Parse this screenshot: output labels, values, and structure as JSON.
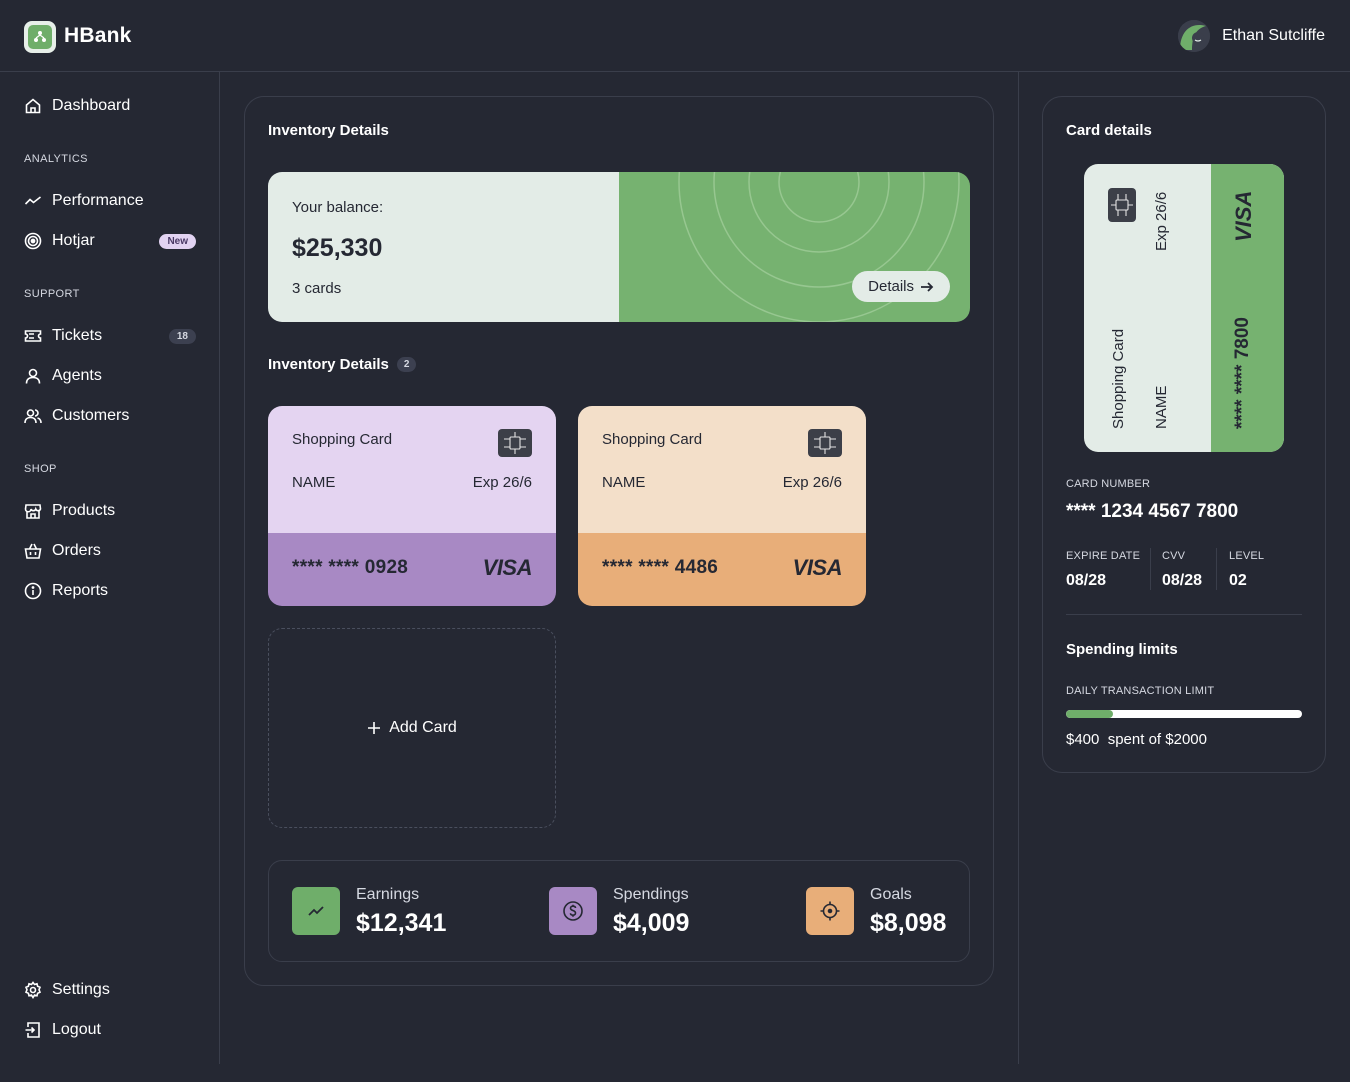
{
  "header": {
    "brand": "HBank",
    "user_name": "Ethan Sutcliffe"
  },
  "sidebar": {
    "dashboard": "Dashboard",
    "analytics_label": "ANALYTICS",
    "performance": "Performance",
    "hotjar": "Hotjar",
    "hotjar_badge": "New",
    "support_label": "SUPPORT",
    "tickets": "Tickets",
    "tickets_count": "18",
    "agents": "Agents",
    "customers": "Customers",
    "shop_label": "SHOP",
    "products": "Products",
    "orders": "Orders",
    "reports": "Reports",
    "settings": "Settings",
    "logout": "Logout"
  },
  "main": {
    "title": "Inventory Details",
    "balance": {
      "label": "Your balance:",
      "amount": "$25,330",
      "cards": "3 cards",
      "details_btn": "Details"
    },
    "cards_section": {
      "title": "Inventory Details",
      "count": "2"
    },
    "cards": [
      {
        "title": "Shopping Card",
        "name": "NAME",
        "exp": "Exp 26/6",
        "number": "**** **** 0928",
        "brand": "VISA",
        "top_color": "#e4d4f1",
        "bottom_color": "#a889c4"
      },
      {
        "title": "Shopping Card",
        "name": "NAME",
        "exp": "Exp 26/6",
        "number": "**** **** 4486",
        "brand": "VISA",
        "top_color": "#f3dfc9",
        "bottom_color": "#e8ae79"
      }
    ],
    "add_card": "Add Card",
    "stats": [
      {
        "label": "Earnings",
        "value": "$12,341",
        "color": "#6fae6a",
        "icon": "trend-up-icon"
      },
      {
        "label": "Spendings",
        "value": "$4,009",
        "color": "#a889c4",
        "icon": "dollar-coin-icon"
      },
      {
        "label": "Goals",
        "value": "$8,098",
        "color": "#e8ae79",
        "icon": "target-icon"
      }
    ]
  },
  "card_details": {
    "title": "Card details",
    "card": {
      "exp": "Exp 26/6",
      "brand": "VISA",
      "title": "Shopping Card",
      "name": "NAME",
      "number": "**** **** 7800"
    },
    "card_number_label": "CARD NUMBER",
    "card_number": "**** 1234 4567 7800",
    "expire_label": "EXPIRE DATE",
    "expire_value": "08/28",
    "cvv_label": "CVV",
    "cvv_value": "08/28",
    "level_label": "LEVEL",
    "level_value": "02",
    "spending_title": "Spending limits",
    "daily_label": "DAILY TRANSACTION LIMIT",
    "spent": "$400",
    "spent_of": "spent of $2000",
    "progress_fraction": 0.2
  },
  "colors": {
    "accent_green": "#76b270",
    "purple": "#a889c4",
    "orange": "#e8ae79",
    "background": "#252833"
  }
}
